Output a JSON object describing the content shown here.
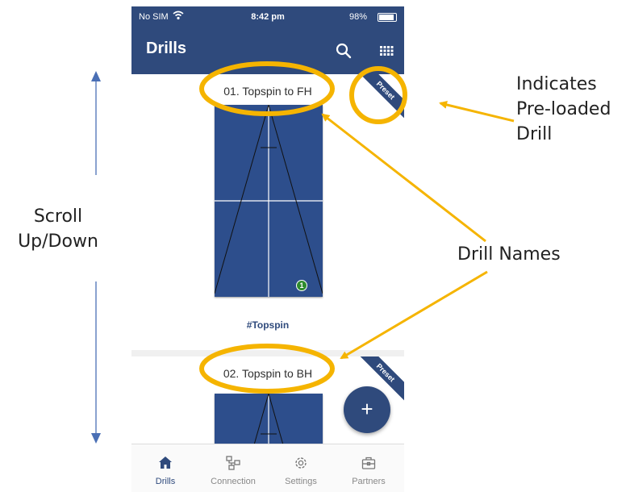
{
  "status_bar": {
    "carrier": "No SIM",
    "time": "8:42 pm",
    "battery": "98%"
  },
  "app_bar": {
    "title": "Drills",
    "icons": [
      "search-icon",
      "grid-icon"
    ]
  },
  "drills": [
    {
      "name": "01. Topspin to FH",
      "badge": "Preset",
      "tag": "#Topspin",
      "marker": "1"
    },
    {
      "name": "02. Topspin to BH",
      "badge": "Preset"
    }
  ],
  "fab": {
    "label": "+"
  },
  "tabs": [
    {
      "label": "Drills",
      "icon": "home-icon",
      "active": true
    },
    {
      "label": "Connection",
      "icon": "connection-icon",
      "active": false
    },
    {
      "label": "Settings",
      "icon": "gear-icon",
      "active": false
    },
    {
      "label": "Partners",
      "icon": "briefcase-icon",
      "active": false
    }
  ],
  "annotations": {
    "scroll_line1": "Scroll",
    "scroll_line2": "Up/Down",
    "preset_line1": "Indicates",
    "preset_line2": "Pre-loaded",
    "preset_line3": "Drill",
    "drill_names": "Drill Names"
  },
  "colors": {
    "primary": "#2f4a7c",
    "highlight": "#f5b400",
    "arrow_blue": "#4a6fb5",
    "marker_green": "#2e8b2e"
  }
}
